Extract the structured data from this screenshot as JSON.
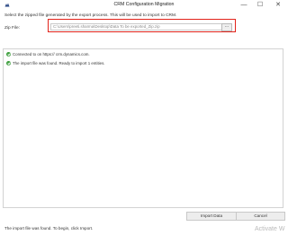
{
  "window": {
    "title": "CRM Configuration Migration",
    "minimize_glyph": "—",
    "maximize_glyph": "☐",
    "close_glyph": "✕"
  },
  "form": {
    "instructions": "Select the zipped file generated by the export process. This will be used to import to CRM.",
    "zip_label": "Zip File:",
    "zip_value": "C:\\Users\\preeti.sharma\\Desktop\\Data To be exported_Zip.zip",
    "browse_label": "..."
  },
  "log": {
    "entries": [
      {
        "text": "Connected to            on https://           crm.dynamics.com."
      },
      {
        "text": "The import file was found. Ready to import 1 entities."
      }
    ]
  },
  "buttons": {
    "import_label": "Import Data",
    "cancel_label": "Cancel"
  },
  "status": {
    "text": "The import file was found. To begin, click Import."
  },
  "watermark": {
    "text": "Activate W"
  },
  "colors": {
    "highlight": "#e2231a",
    "success": "#3e9f3e",
    "app_icon": "#2b4a86"
  },
  "icons": [
    "app-logo-icon",
    "check-circle-icon"
  ]
}
